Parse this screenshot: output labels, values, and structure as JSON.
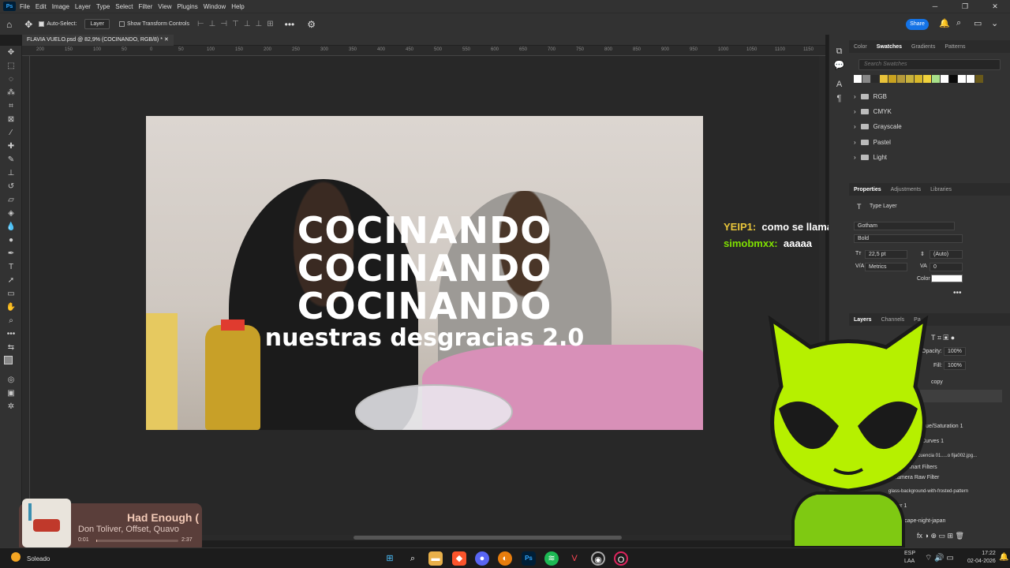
{
  "menubar": {
    "app_icon": "Ps",
    "items": [
      "File",
      "Edit",
      "Image",
      "Layer",
      "Type",
      "Select",
      "Filter",
      "View",
      "Plugins",
      "Window",
      "Help"
    ]
  },
  "options": {
    "auto_select_label": "Auto-Select:",
    "auto_select_value": "Layer",
    "transform_label": "Show Transform Controls",
    "share_label": "Share"
  },
  "document": {
    "tab_title": "FLAVIA VUELO.psd @ 82,9% (COCINANDO, RGB/8) *",
    "ruler_ticks": [
      "200",
      "150",
      "100",
      "50",
      "0",
      "50",
      "100",
      "150",
      "200",
      "250",
      "300",
      "350",
      "400",
      "450",
      "500",
      "550",
      "600",
      "650",
      "700",
      "750",
      "800",
      "850",
      "900",
      "950",
      "1000",
      "1050",
      "1100",
      "1150",
      "1200"
    ]
  },
  "canvas": {
    "line1": "COCINANDO",
    "line2": "COCINANDO",
    "line3": "COCINANDO",
    "line4": "nuestras desgracias 2.0"
  },
  "swatches": {
    "tabs": [
      "Color",
      "Swatches",
      "Gradients",
      "Patterns"
    ],
    "active_tab": "Swatches",
    "search_placeholder": "Search Swatches",
    "colors": [
      "#ffffff",
      "#888888",
      "#2a2a2a",
      "#e8c23a",
      "#c9a21f",
      "#b59a3a",
      "#c8b23c",
      "#d8b82a",
      "#f0d23c",
      "#a8e08a",
      "#ffffff",
      "#0a0a0a",
      "#ffffff",
      "#ffffff",
      "#6a5a1a"
    ],
    "folders": [
      "RGB",
      "CMYK",
      "Grayscale",
      "Pastel",
      "Light"
    ]
  },
  "properties": {
    "tabs": [
      "Properties",
      "Adjustments",
      "Libraries"
    ],
    "active_tab": "Properties",
    "kind": "Type Layer",
    "font": "Gotham",
    "style": "Bold",
    "size": "22,5 pt",
    "leading": "(Auto)",
    "kerning": "Metrics",
    "tracking": "0",
    "color_label": "Color",
    "color": "#ffffff"
  },
  "layers": {
    "tabs": [
      "Layers",
      "Channels",
      "Pa"
    ],
    "active_tab": "Layers",
    "opacity_label": "Opacity:",
    "opacity": "100%",
    "fill_label": "Fill:",
    "fill": "100%",
    "items": [
      "copy",
      "Hue/Saturation 1",
      "Curves 1",
      "Secuencia 01.....o fija002.jpg...",
      "Smart Filters",
      "Camera Raw Filter",
      "glass-background-with-frosted-pattern",
      "Layer 1",
      "o-cityscape-night-japan"
    ]
  },
  "chat": [
    {
      "user": "YEIP1:",
      "color": "#e8c53a",
      "message": "como se llama"
    },
    {
      "user": "simobmxx:",
      "color": "#7fe000",
      "message": "aaaaa"
    }
  ],
  "media": {
    "title": "Had Enough (",
    "artist": "Don Toliver, Offset, Quavo",
    "elapsed": "0:01",
    "duration": "2:37",
    "progress": 0.006
  },
  "taskbar": {
    "weather": "Soleado",
    "lang1": "ESP",
    "lang2": "LAA",
    "time": "17:22",
    "date": "02-04-2026"
  }
}
